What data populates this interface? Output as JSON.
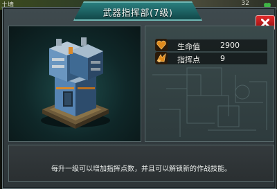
{
  "background": {
    "left_text": "土墙",
    "right_text": "32"
  },
  "dialog": {
    "title": "武器指挥部(7级)",
    "close_icon": "close-x-icon",
    "stats": [
      {
        "label": "生命值",
        "value": "2900",
        "icon": "heart-icon"
      },
      {
        "label": "指挥点",
        "value": "9",
        "icon": "command-point-icon"
      }
    ],
    "description": "每升一级可以增加指挥点数，并且可以解锁新的作战技能。"
  },
  "colors": {
    "title_tab": "#1d6a6a",
    "close_button": "#c81d1d",
    "panel_bg": "#384346",
    "stat_icon_orange": "#e08a1c"
  }
}
